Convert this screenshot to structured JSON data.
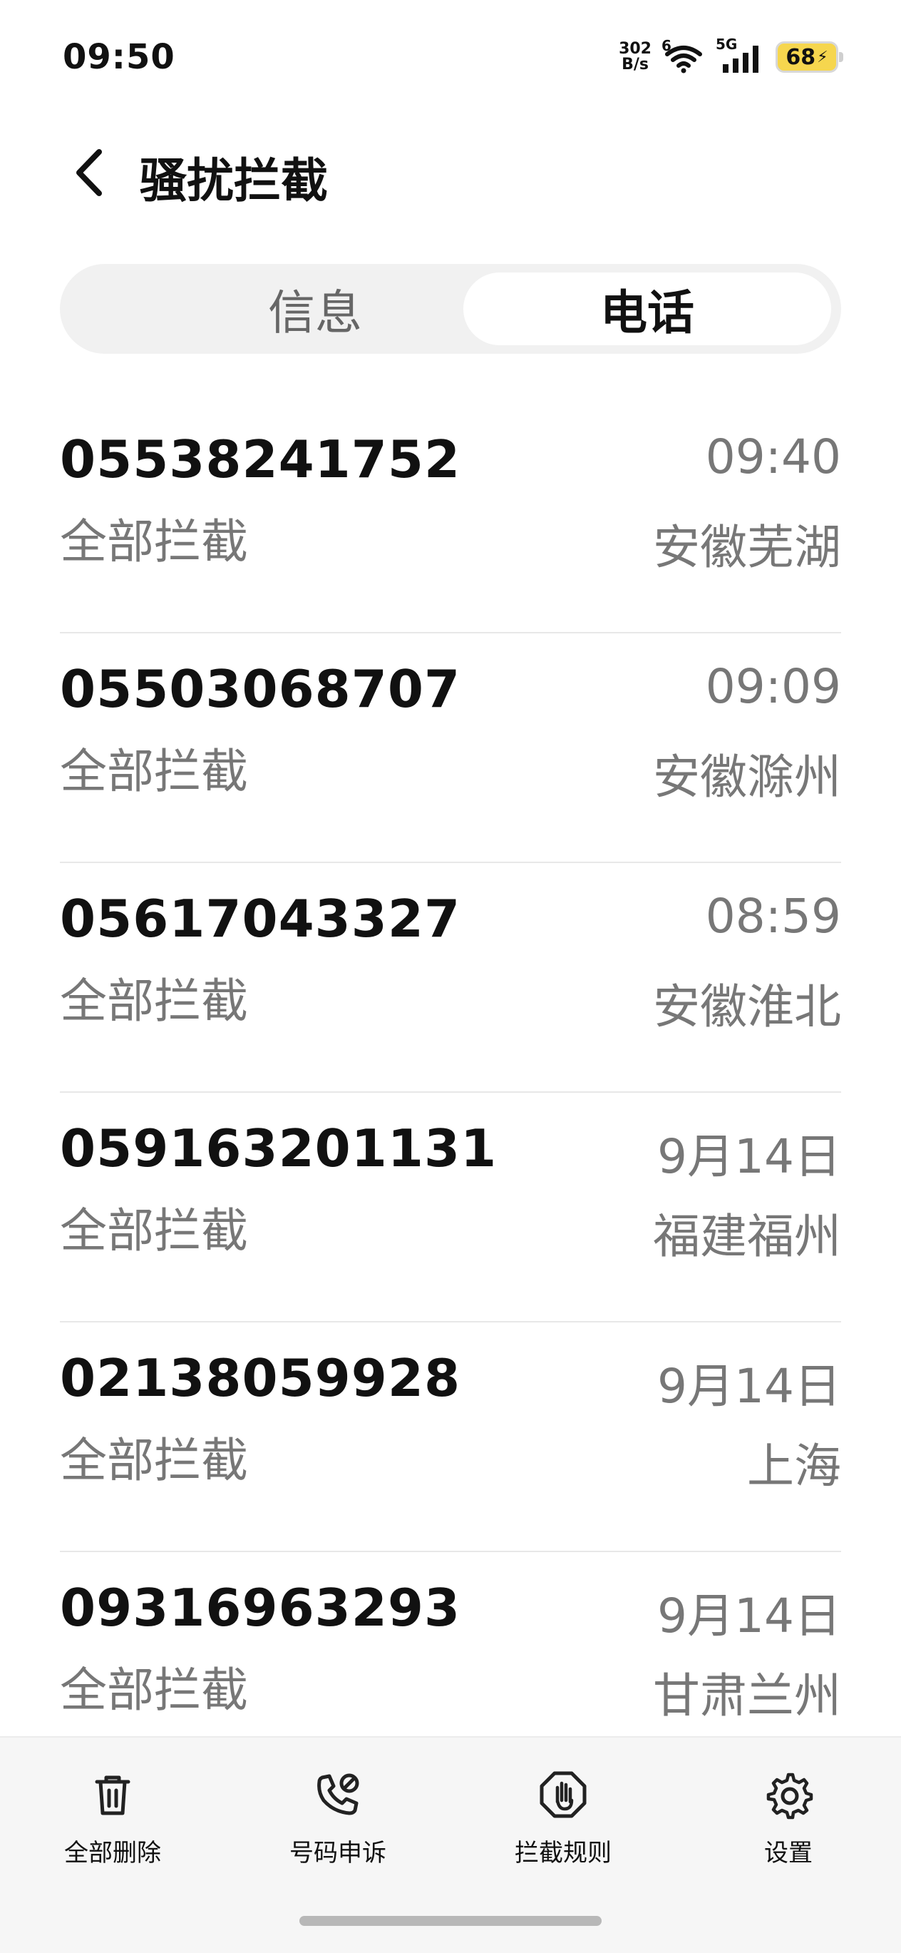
{
  "status_bar": {
    "time": "09:50",
    "net_speed_value": "302",
    "net_speed_unit": "B/s",
    "wifi_label": "6",
    "signal_label": "5G",
    "battery": "68"
  },
  "header": {
    "title": "骚扰拦截"
  },
  "tabs": [
    {
      "label": "信息",
      "selected": false
    },
    {
      "label": "电话",
      "selected": true
    }
  ],
  "calls": [
    {
      "number": "05538241752",
      "type": "全部拦截",
      "time": "09:40",
      "location": "安徽芜湖"
    },
    {
      "number": "05503068707",
      "type": "全部拦截",
      "time": "09:09",
      "location": "安徽滁州"
    },
    {
      "number": "05617043327",
      "type": "全部拦截",
      "time": "08:59",
      "location": "安徽淮北"
    },
    {
      "number": "059163201131",
      "type": "全部拦截",
      "time": "9月14日",
      "location": "福建福州"
    },
    {
      "number": "02138059928",
      "type": "全部拦截",
      "time": "9月14日",
      "location": "上海"
    },
    {
      "number": "09316963293",
      "type": "全部拦截",
      "time": "9月14日",
      "location": "甘肃兰州"
    }
  ],
  "toolbar": {
    "delete_all": {
      "label": "全部删除",
      "icon": "trash-icon"
    },
    "appeal": {
      "label": "号码申诉",
      "icon": "phone-appeal-icon"
    },
    "rules": {
      "label": "拦截规则",
      "icon": "block-hand-icon"
    },
    "settings": {
      "label": "设置",
      "icon": "gear-icon"
    }
  }
}
